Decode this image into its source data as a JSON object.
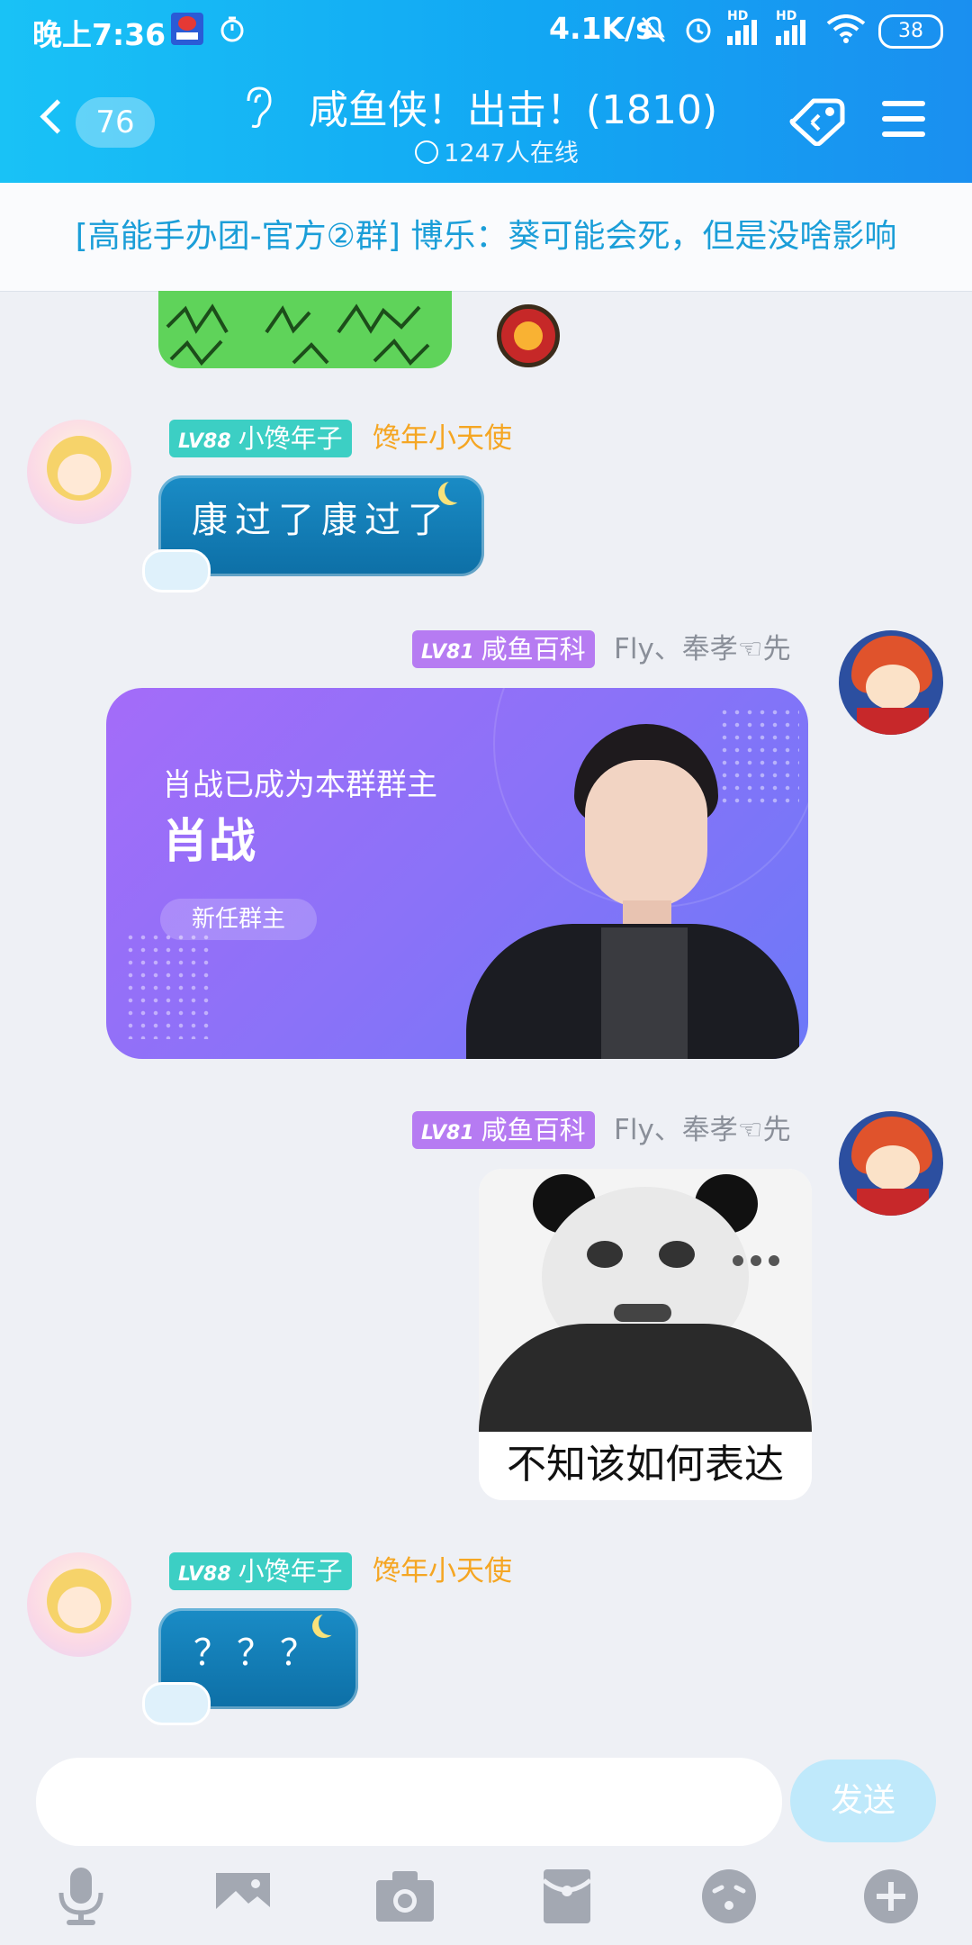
{
  "status_bar": {
    "time": "晚上7:36",
    "net_speed": "4.1K/s",
    "signal_1": "HD",
    "signal_2": "HD",
    "battery": "38"
  },
  "header": {
    "unread_count": "76",
    "group_name": "咸鱼侠！出击！(1810)",
    "online_count": "1247人在线"
  },
  "announcement": {
    "text": "[高能手办团-官方②群] 博乐：葵可能会死，但是没啥影响"
  },
  "messages": [
    {
      "sender_level": "LV88",
      "sender_name": "小馋年子",
      "sender_title": "馋年小天使",
      "text": "康过了康过了"
    },
    {
      "sender_level": "LV81",
      "sender_name": "咸鱼百科",
      "sender_title": "Fly、奉孝☜先",
      "card": {
        "headline": "肖战已成为本群群主",
        "name": "肖战",
        "tag": "新任群主"
      }
    },
    {
      "sender_level": "LV81",
      "sender_name": "咸鱼百科",
      "sender_title": "Fly、奉孝☜先",
      "sticker_caption": "不知该如何表达"
    },
    {
      "sender_level": "LV88",
      "sender_name": "小馋年子",
      "sender_title": "馋年小天使",
      "text": "？？？"
    }
  ],
  "composer": {
    "placeholder": "",
    "send_label": "发送"
  },
  "toolbar": [
    "microphone-icon",
    "image-icon",
    "camera-icon",
    "red-packet-icon",
    "emoji-icon",
    "plus-icon"
  ],
  "colors": {
    "header_gradient_start": "#19c2f6",
    "header_gradient_end": "#1a8ff0",
    "level_badge_green": "#3ccfc4",
    "level_badge_purple": "#b67bf2",
    "card_gradient_start": "#a46cf9",
    "card_gradient_end": "#6c79f8"
  }
}
